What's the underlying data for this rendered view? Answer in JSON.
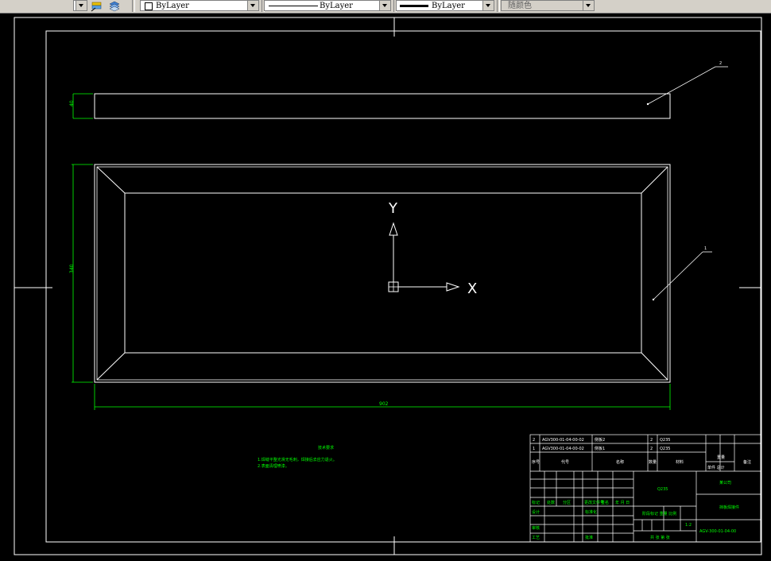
{
  "toolbar": {
    "layer_color_dropdown": "ByLayer",
    "linetype_dropdown": "ByLayer",
    "lineweight_dropdown": "ByLayer",
    "plot_color_dropdown": "随颜色"
  },
  "drawing": {
    "balloon_top": "2",
    "balloon_main": "1",
    "dim_height_small": "40",
    "dim_height_main": "340",
    "dim_width": "902",
    "ucs_x_label": "X",
    "ucs_y_label": "Y",
    "note_title": "技术要求",
    "note_line1": "1.焊缝平整光滑无毛刺，焊接后去应力退火。",
    "note_line2": "2.表面清理喷漆。"
  },
  "title_block": {
    "bom": [
      {
        "no": "2",
        "code": "AGV300-01-04-00-02",
        "name": "侧板2",
        "qty": "2",
        "material": "Q235"
      },
      {
        "no": "1",
        "code": "AGV300-01-04-00-02",
        "name": "侧板1",
        "qty": "2",
        "material": "Q235"
      }
    ],
    "bom_headers": {
      "no": "序号",
      "code": "代号",
      "name": "名称",
      "qty": "数量",
      "material": "材料",
      "unit_total": "单件 总计",
      "weight": "重量",
      "remark": "备注"
    },
    "material_cell": "Q235",
    "company": "某公司",
    "drawing_name": "挡板焊接件",
    "drawing_code": "AGV-300-01-04-00",
    "labels_row": [
      "标记",
      "处数",
      "分区",
      "更改文件号",
      "签名",
      "年 月 日"
    ],
    "design_row": [
      "设计",
      "标准化"
    ],
    "review": "审核",
    "process": "工艺",
    "approve": "批准",
    "stage_labels": "阶段标记  重量  比例",
    "scale": "1:2",
    "sheet": "共 张 第 张"
  }
}
